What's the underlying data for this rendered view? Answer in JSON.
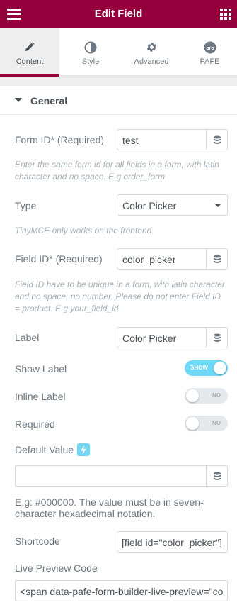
{
  "header": {
    "title": "Edit Field"
  },
  "tabs": [
    {
      "label": "Content"
    },
    {
      "label": "Style"
    },
    {
      "label": "Advanced"
    },
    {
      "label": "PAFE"
    }
  ],
  "section": {
    "title": "General"
  },
  "fields": {
    "form_id": {
      "label": "Form ID* (Required)",
      "value": "test",
      "description": "Enter the same form id for all fields in a form, with latin character and no space. E.g order_form"
    },
    "type": {
      "label": "Type",
      "value": "Color Picker",
      "description": "TinyMCE only works on the frontend."
    },
    "field_id": {
      "label": "Field ID* (Required)",
      "value": "color_picker",
      "description": "Field ID have to be unique in a form, with latin character and no space, no number. Please do not enter Field ID = product. E.g your_field_id"
    },
    "label": {
      "label": "Label",
      "value": "Color Picker"
    },
    "show_label": {
      "label": "Show Label",
      "state": "SHOW"
    },
    "inline_label": {
      "label": "Inline Label",
      "state": "NO"
    },
    "required": {
      "label": "Required",
      "state": "NO"
    },
    "default_value": {
      "label": "Default Value",
      "value": "",
      "description": "E.g: #000000. The value must be in seven-character hexadecimal notation."
    },
    "shortcode": {
      "label": "Shortcode",
      "value": "[field id=\"color_picker\"]"
    },
    "live_preview": {
      "label": "Live Preview Code",
      "value": "<span data-pafe-form-builder-live-preview=\"colo"
    }
  },
  "colors": {
    "brand": "#93003c",
    "toggle_on": "#71d7f7"
  }
}
